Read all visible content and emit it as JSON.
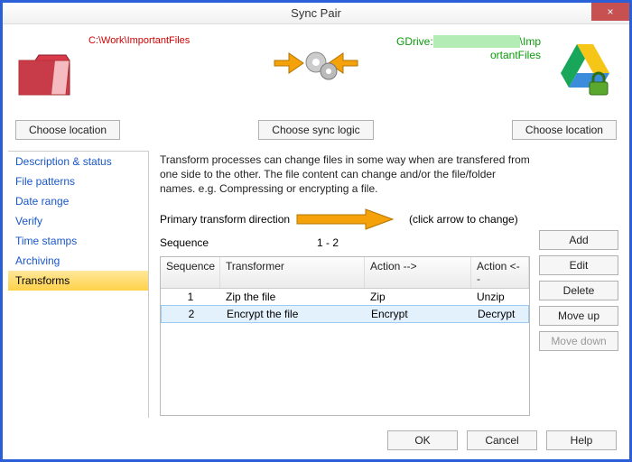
{
  "window": {
    "title": "Sync Pair"
  },
  "icons": {
    "close": "×"
  },
  "paths": {
    "left": "C:\\Work\\ImportantFiles",
    "right_line1": "GDrive:",
    "right_line2": "\\Imp",
    "right_line3": "ortantFiles"
  },
  "buttons": {
    "choose_left": "Choose location",
    "choose_logic": "Choose sync logic",
    "choose_right": "Choose location",
    "add": "Add",
    "edit": "Edit",
    "delete": "Delete",
    "move_up": "Move up",
    "move_down": "Move down",
    "ok": "OK",
    "cancel": "Cancel",
    "help": "Help"
  },
  "sidebar": {
    "items": [
      {
        "label": "Description & status"
      },
      {
        "label": "File patterns"
      },
      {
        "label": "Date range"
      },
      {
        "label": "Verify"
      },
      {
        "label": "Time stamps"
      },
      {
        "label": "Archiving"
      },
      {
        "label": "Transforms"
      }
    ],
    "selected_index": 6
  },
  "main": {
    "description": "Transform processes can change files in some way when are transfered from one side to the other.  The file content can change and/or the file/folder names.  e.g. Compressing or encrypting a file.",
    "ptd_label": "Primary transform direction",
    "ptd_hint": "(click arrow to change)",
    "sequence_label": "Sequence",
    "sequence_value": "1 - 2",
    "headers": {
      "c0": "Sequence",
      "c1": "Transformer",
      "c2": "Action -->",
      "c3": "Action <--"
    },
    "rows": [
      {
        "seq": "1",
        "transformer": "Zip the file",
        "fwd": "Zip",
        "rev": "Unzip"
      },
      {
        "seq": "2",
        "transformer": "Encrypt the file",
        "fwd": "Encrypt",
        "rev": "Decrypt"
      }
    ],
    "selected_row": 1
  }
}
